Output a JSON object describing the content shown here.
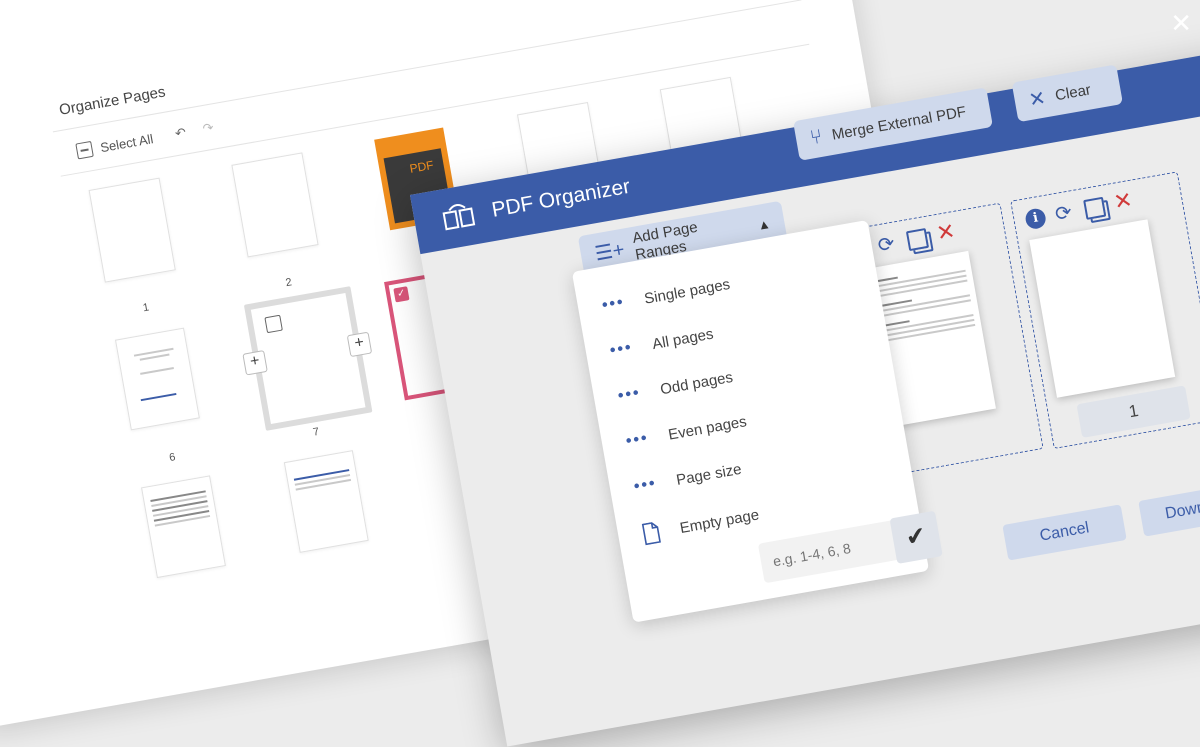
{
  "back_window": {
    "title": "Organize Pages",
    "select_all": "Select All",
    "page_numbers": [
      "1",
      "2",
      "6",
      "7"
    ]
  },
  "organizer": {
    "title": "PDF Organizer",
    "add_page_ranges": "Add Page Ranges",
    "merge_label": "Merge External PDF",
    "clear_label": "Clear",
    "page_number": "1",
    "cancel_label": "Cancel",
    "download_label": "Download"
  },
  "dropdown": {
    "items": [
      "Single pages",
      "All pages",
      "Odd pages",
      "Even pages",
      "Page size",
      "Empty page"
    ],
    "range_placeholder": "e.g. 1-4, 6, 8"
  },
  "icons": {
    "logo": "pdf-organizer-logo-icon",
    "add_ranges": "list-add-icon",
    "merge": "merge-icon",
    "clear": "close-icon",
    "info": "info-icon",
    "rotate": "rotate-icon",
    "duplicate": "duplicate-icon",
    "delete": "delete-icon",
    "confirm": "checkmark-icon"
  },
  "colors": {
    "accent": "#3b5ca8",
    "accent_light": "#cfd9ec",
    "delete": "#d03a3a",
    "selected": "#d9557a"
  }
}
